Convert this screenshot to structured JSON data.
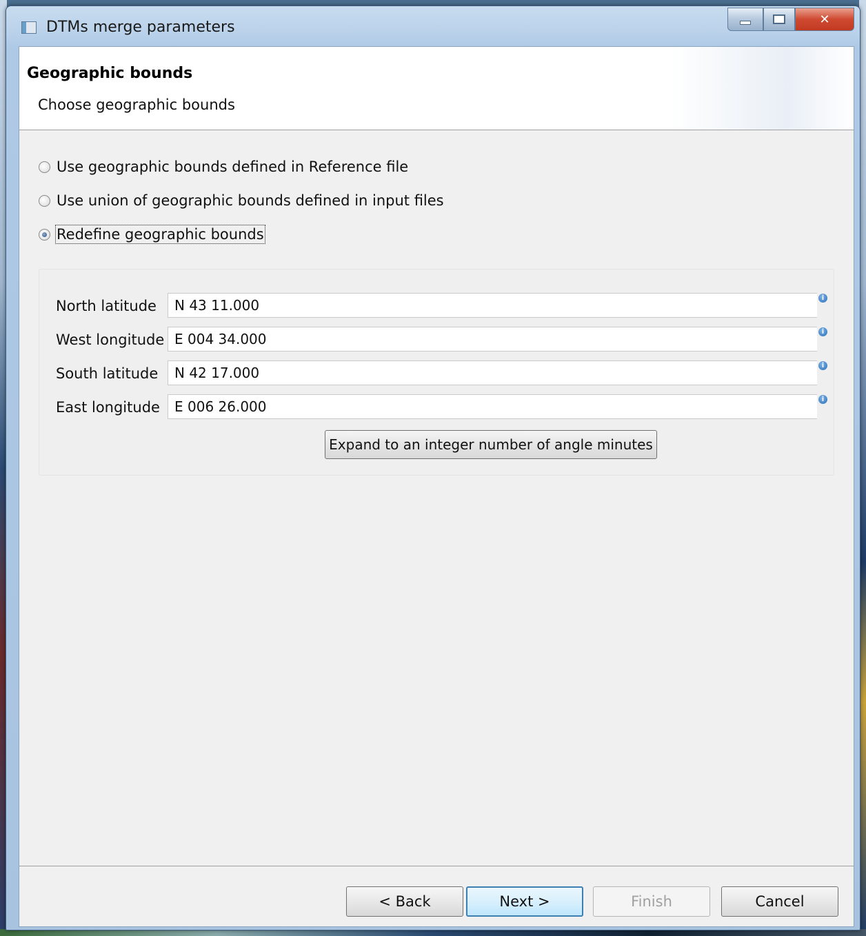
{
  "window": {
    "title": "DTMs merge parameters"
  },
  "header": {
    "title": "Geographic bounds",
    "subtitle": "Choose geographic bounds"
  },
  "options": [
    {
      "label": "Use geographic bounds defined in Reference file",
      "checked": false
    },
    {
      "label": "Use union of geographic bounds defined in input files",
      "checked": false
    },
    {
      "label": "Redefine geographic bounds",
      "checked": true
    }
  ],
  "bounds": {
    "north": {
      "label": "North latitude",
      "value": "N 43 11.000"
    },
    "west": {
      "label": "West longitude",
      "value": "E 004 34.000"
    },
    "south": {
      "label": "South latitude",
      "value": "N 42 17.000"
    },
    "east": {
      "label": "East longitude",
      "value": "E 006 26.000"
    },
    "info_glyph": "i",
    "expand_label": "Expand to an integer number of angle minutes"
  },
  "footer": {
    "back_label": "< Back",
    "next_label": "Next >",
    "finish_label": "Finish",
    "cancel_label": "Cancel"
  }
}
